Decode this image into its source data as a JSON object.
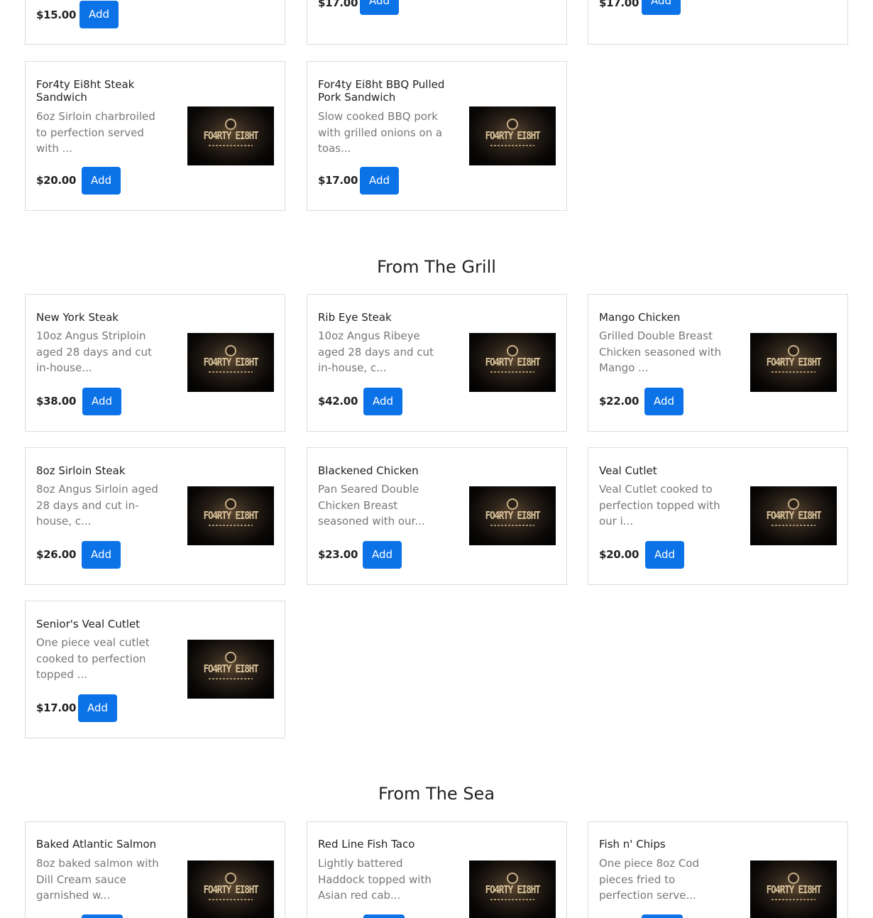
{
  "brand": {
    "logo_text": "FO4RTY EI8HT"
  },
  "top_row": [
    {
      "price": "$15.00",
      "add_label": "Add"
    },
    {
      "price": "$17.00",
      "add_label": "Add"
    },
    {
      "price": "$17.00",
      "add_label": "Add"
    }
  ],
  "sandwiches": [
    {
      "name": "For4ty Ei8ht Steak Sandwich",
      "desc": "6oz Sirloin charbroiled to perfection served with ...",
      "price": "$20.00",
      "add_label": "Add"
    },
    {
      "name": "For4ty Ei8ht BBQ Pulled Pork Sandwich",
      "desc": "Slow cooked BBQ pork with grilled onions on a toas...",
      "price": "$17.00",
      "add_label": "Add"
    }
  ],
  "grill": {
    "title": "From The Grill",
    "items": [
      {
        "name": "New York Steak",
        "desc": "10oz Angus Striploin aged 28 days and cut in-house...",
        "price": "$38.00",
        "add_label": "Add"
      },
      {
        "name": "Rib Eye Steak",
        "desc": "10oz Angus Ribeye aged 28 days and cut in-house, c...",
        "price": "$42.00",
        "add_label": "Add"
      },
      {
        "name": "Mango Chicken",
        "desc": "Grilled Double Breast Chicken seasoned with Mango ...",
        "price": "$22.00",
        "add_label": "Add"
      },
      {
        "name": "8oz Sirloin Steak",
        "desc": "8oz Angus Sirloin aged 28 days and cut in-house, c...",
        "price": "$26.00",
        "add_label": "Add"
      },
      {
        "name": "Blackened Chicken",
        "desc": "Pan Seared Double Chicken Breast seasoned with our...",
        "price": "$23.00",
        "add_label": "Add"
      },
      {
        "name": "Veal Cutlet",
        "desc": "Veal Cutlet cooked to perfection topped with our i...",
        "price": "$20.00",
        "add_label": "Add"
      },
      {
        "name": "Senior's Veal Cutlet",
        "desc": "One piece veal cutlet cooked to perfection topped ...",
        "price": "$17.00",
        "add_label": "Add"
      }
    ]
  },
  "sea": {
    "title": "From The Sea",
    "items": [
      {
        "name": "Baked Atlantic Salmon",
        "desc": "8oz baked salmon with Dill Cream sauce garnished w..."
      },
      {
        "name": "Red Line Fish Taco",
        "desc": "Lightly battered Haddock topped with Asian red cab..."
      },
      {
        "name": "Fish n' Chips",
        "desc": "One piece 8oz Cod pieces fried to perfection serve..."
      }
    ]
  }
}
